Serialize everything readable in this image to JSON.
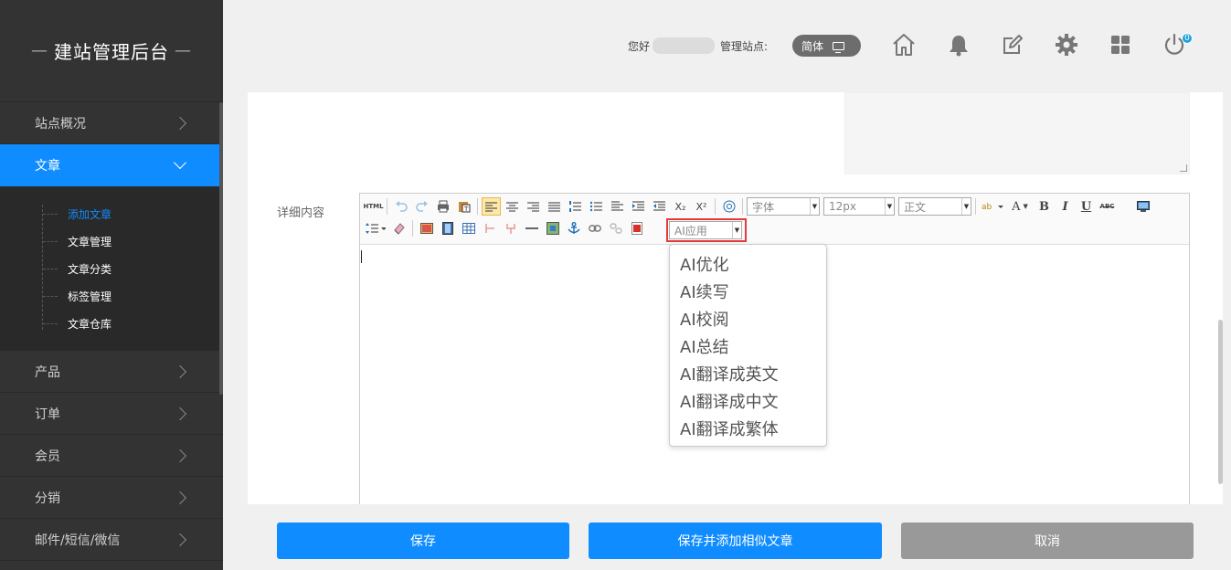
{
  "sidebar": {
    "brand": "建站管理后台",
    "brand_dash": "—",
    "items": [
      {
        "label": "站点概况"
      },
      {
        "label": "文章"
      },
      {
        "label": "产品"
      },
      {
        "label": "订单"
      },
      {
        "label": "会员"
      },
      {
        "label": "分销"
      },
      {
        "label": "邮件/短信/微信"
      }
    ],
    "subitems": [
      {
        "label": "添加文章"
      },
      {
        "label": "文章管理"
      },
      {
        "label": "文章分类"
      },
      {
        "label": "标签管理"
      },
      {
        "label": "文章仓库"
      }
    ]
  },
  "header": {
    "greeting": "您好",
    "site_label": "管理站点:",
    "lang": "简体",
    "notification_count": "0",
    "icons": [
      "home-icon",
      "bell-icon",
      "edit-icon",
      "gear-icon",
      "apps-icon",
      "power-icon"
    ]
  },
  "form": {
    "detail_label": "详细内容"
  },
  "editor": {
    "html_label": "HTML",
    "font_family": "字体",
    "font_size": "12px",
    "paragraph": "正文",
    "ai_select": "AI应用",
    "bold": "B",
    "italic": "I",
    "underline": "U",
    "strike": "ABC",
    "font_color": "A",
    "subscript": "X₂",
    "superscript": "X²"
  },
  "ai_menu": {
    "options": [
      "AI优化",
      "AI续写",
      "AI校阅",
      "AI总结",
      "AI翻译成英文",
      "AI翻译成中文",
      "AI翻译成繁体"
    ]
  },
  "buttons": {
    "save": "保存",
    "save_add": "保存并添加相似文章",
    "cancel": "取消"
  },
  "colors": {
    "accent": "#0f8cff",
    "sidebar_bg": "#333333",
    "highlight_border": "#e43a3a"
  }
}
